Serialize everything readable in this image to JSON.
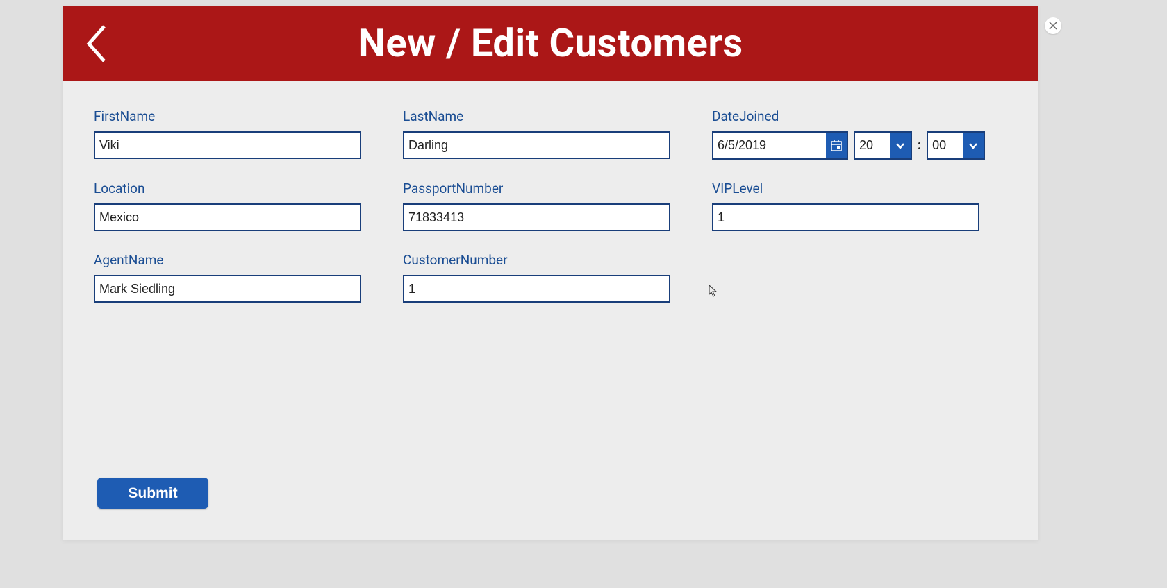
{
  "header": {
    "title": "New / Edit Customers"
  },
  "form": {
    "firstName": {
      "label": "FirstName",
      "value": "Viki"
    },
    "lastName": {
      "label": "LastName",
      "value": "Darling"
    },
    "dateJoined": {
      "label": "DateJoined",
      "date": "6/5/2019",
      "hour": "20",
      "minute": "00",
      "separator": ":"
    },
    "location": {
      "label": "Location",
      "value": "Mexico"
    },
    "passportNumber": {
      "label": "PassportNumber",
      "value": "71833413"
    },
    "vipLevel": {
      "label": "VIPLevel",
      "value": "1"
    },
    "agentName": {
      "label": "AgentName",
      "value": "Mark Siedling"
    },
    "customerNumber": {
      "label": "CustomerNumber",
      "value": "1"
    }
  },
  "buttons": {
    "submit": "Submit"
  },
  "colors": {
    "headerBg": "#ab1717",
    "accent": "#1e5cb3",
    "inputBorder": "#193e7a",
    "labelText": "#1a4d93"
  }
}
